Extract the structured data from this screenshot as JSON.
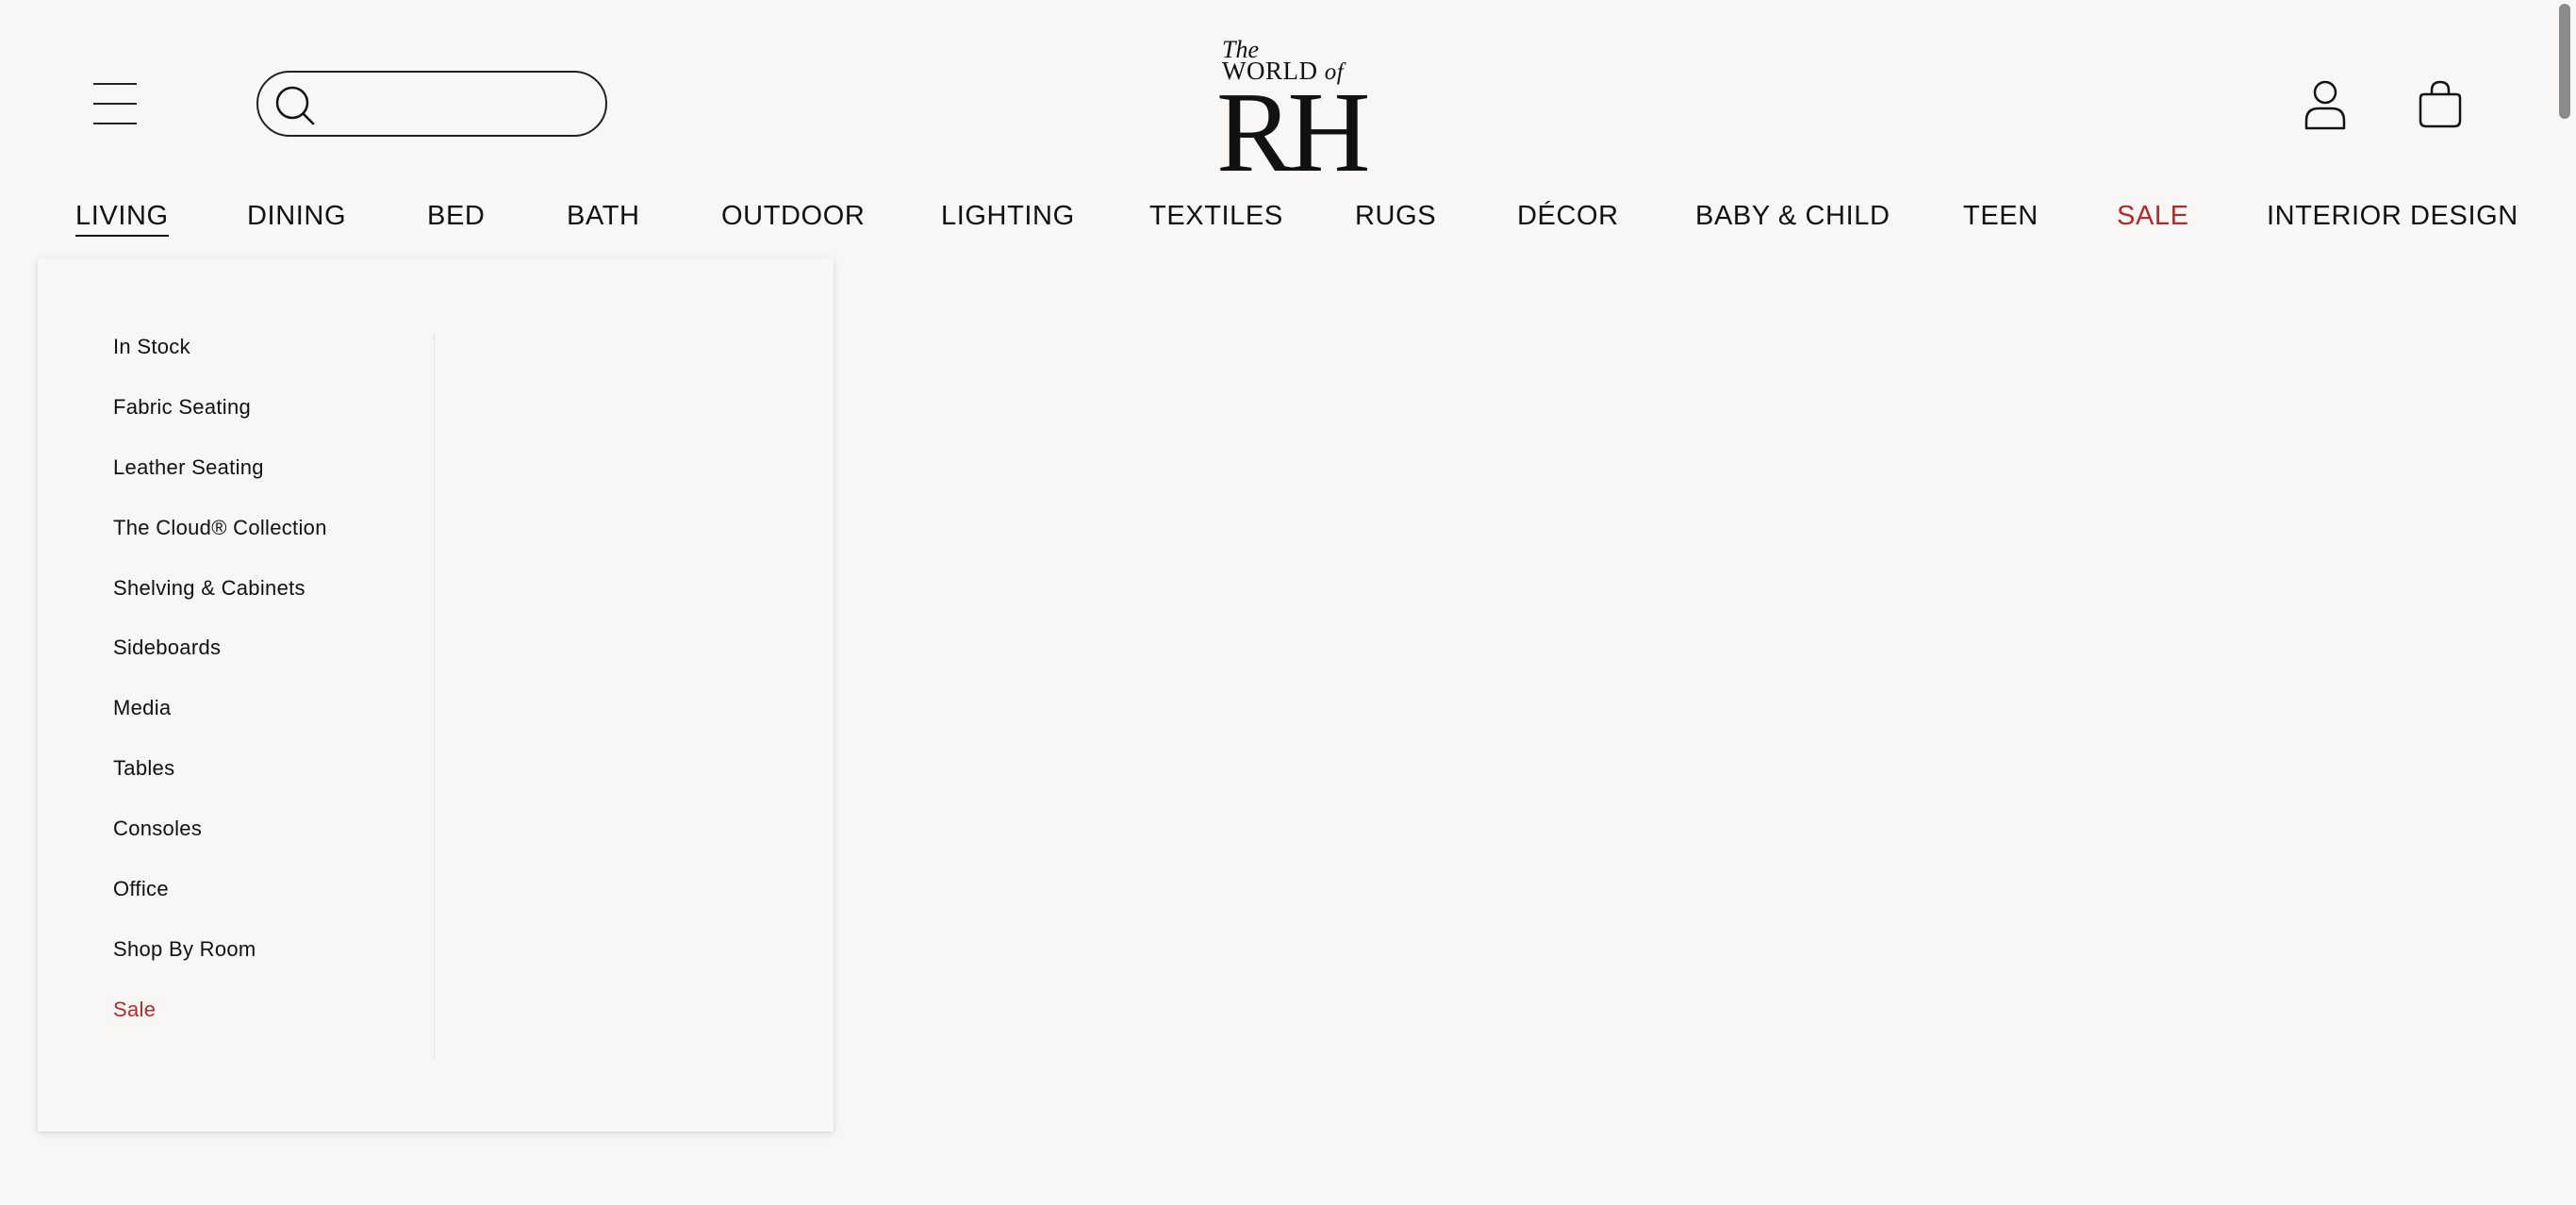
{
  "header": {
    "search": {
      "placeholder": "",
      "value": ""
    },
    "logo": {
      "line1": "The",
      "line2_main": "WORLD",
      "line2_suffix": "of",
      "mark": "RH"
    }
  },
  "nav": {
    "items": [
      {
        "label": "LIVING",
        "active": true
      },
      {
        "label": "DINING"
      },
      {
        "label": "BED"
      },
      {
        "label": "BATH"
      },
      {
        "label": "OUTDOOR"
      },
      {
        "label": "LIGHTING"
      },
      {
        "label": "TEXTILES"
      },
      {
        "label": "RUGS"
      },
      {
        "label": "DÉCOR"
      },
      {
        "label": "BABY & CHILD"
      },
      {
        "label": "TEEN"
      },
      {
        "label": "SALE",
        "color": "#b52b2b"
      },
      {
        "label": "INTERIOR DESIGN"
      }
    ]
  },
  "dropdown": {
    "items": [
      {
        "label": "In Stock"
      },
      {
        "label": "Fabric Seating"
      },
      {
        "label": "Leather Seating"
      },
      {
        "label": "The Cloud® Collection"
      },
      {
        "label": "Shelving & Cabinets"
      },
      {
        "label": "Sideboards"
      },
      {
        "label": "Media"
      },
      {
        "label": "Tables"
      },
      {
        "label": "Consoles"
      },
      {
        "label": "Office"
      },
      {
        "label": "Shop By Room"
      },
      {
        "label": "Sale",
        "color": "#b52b2b"
      }
    ]
  },
  "icons": {
    "menu": "hamburger-menu-icon",
    "search": "search-icon",
    "account": "account-icon",
    "cart": "shopping-bag-icon"
  },
  "colors": {
    "background": "#f8f7f5",
    "text": "#111111",
    "sale": "#b52b2b"
  }
}
